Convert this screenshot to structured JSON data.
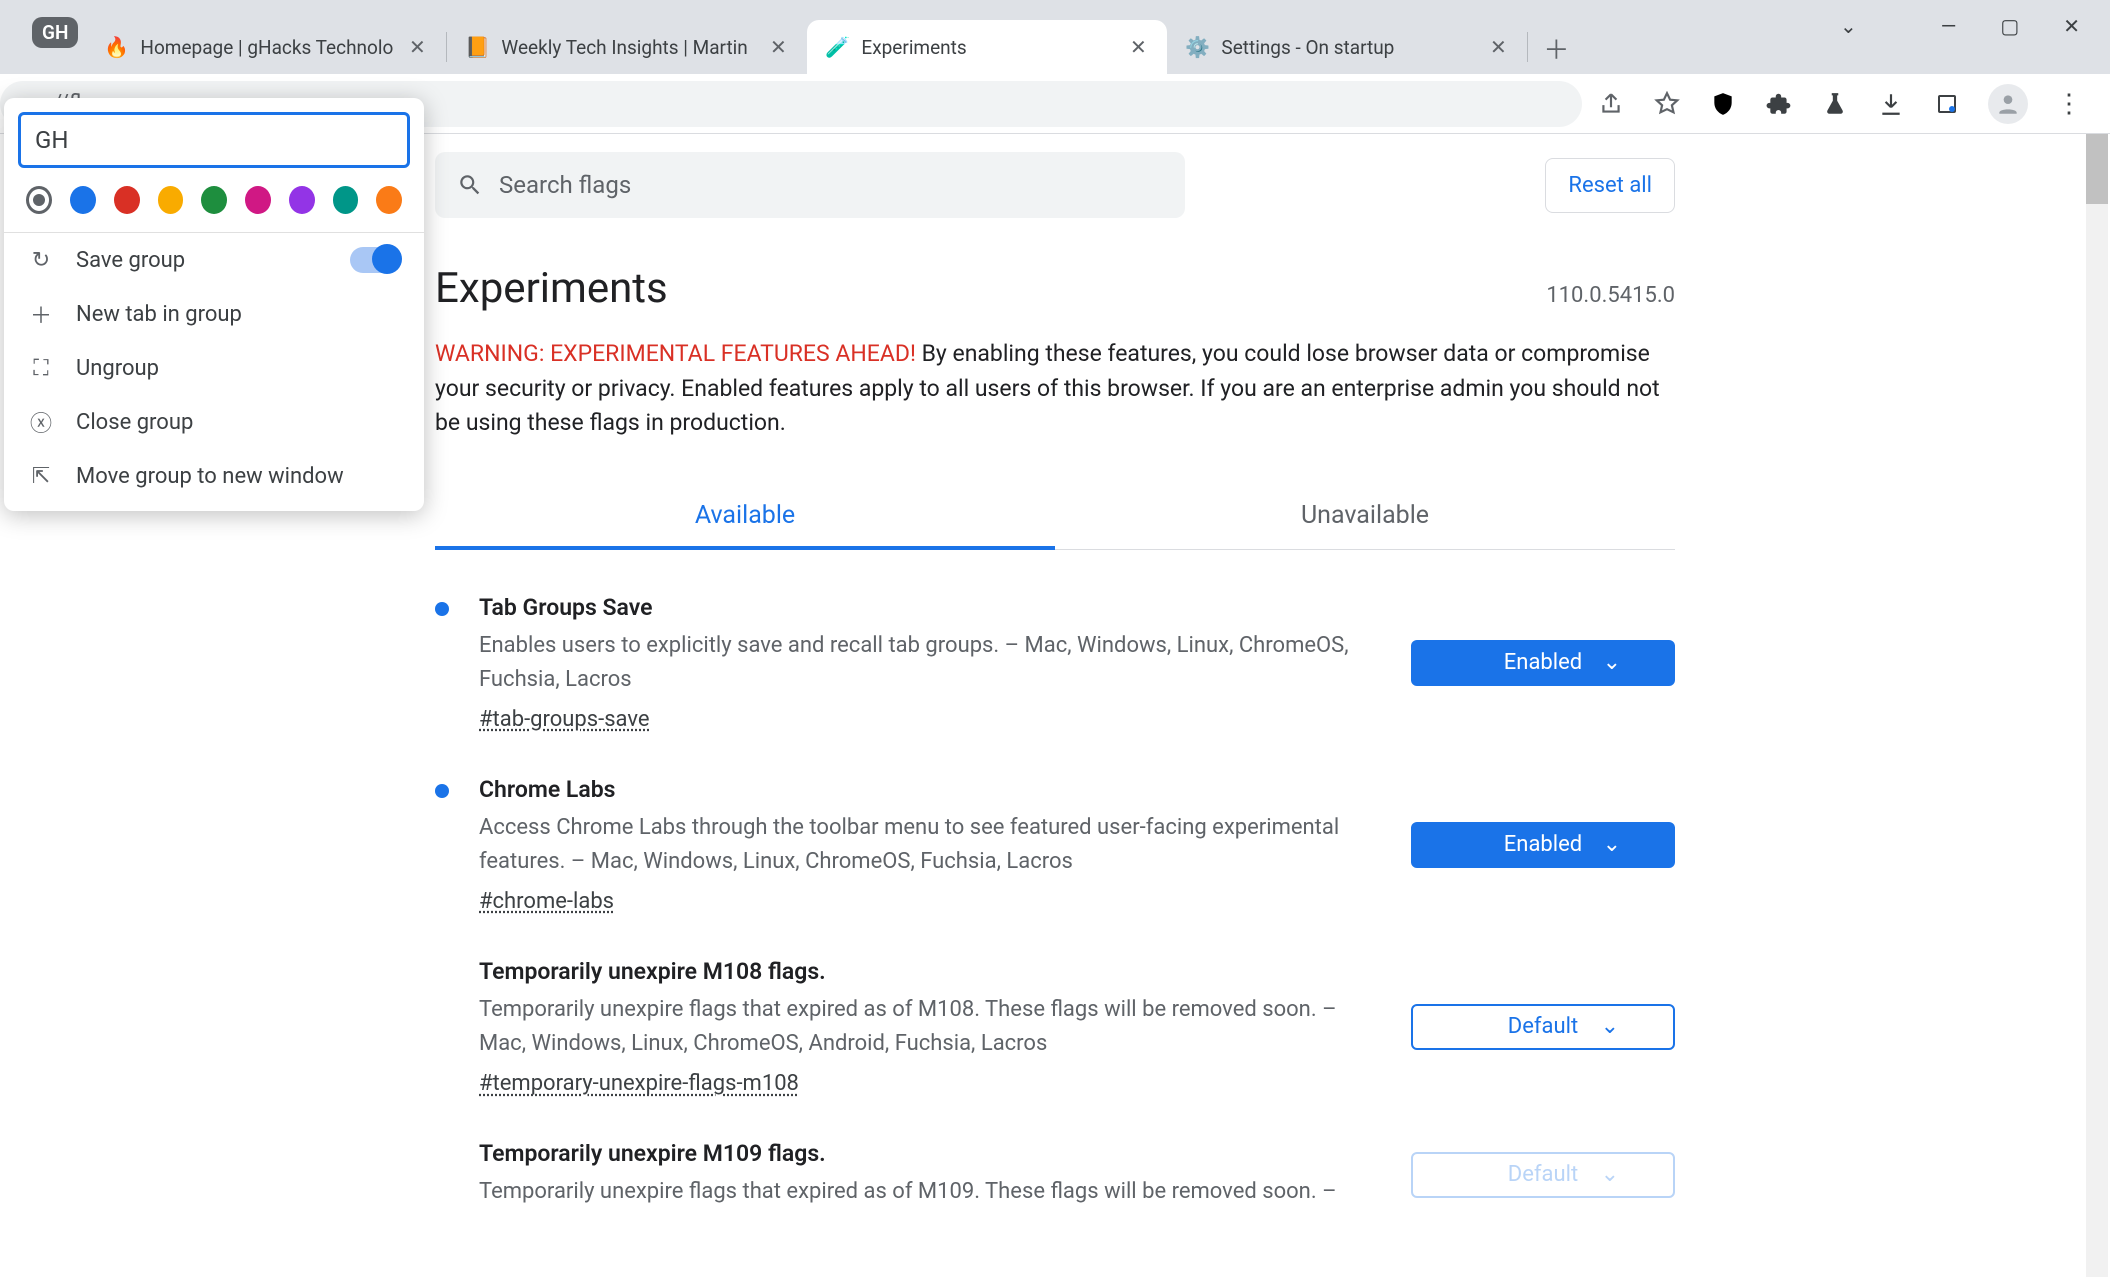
{
  "window": {
    "group_chip": "GH",
    "tabs": [
      {
        "title": "Homepage | gHacks Technolo",
        "active": false
      },
      {
        "title": "Weekly Tech Insights | Martin",
        "active": false
      },
      {
        "title": "Experiments",
        "active": true
      },
      {
        "title": "Settings - On startup",
        "active": false
      }
    ]
  },
  "omnibox": {
    "fragment": "ne://flags"
  },
  "group_popup": {
    "name_value": "GH",
    "colors": [
      "#5f6368",
      "#1a73e8",
      "#d93025",
      "#f9ab00",
      "#1e8e3e",
      "#d01884",
      "#9334e6",
      "#009688",
      "#fa7b17"
    ],
    "items": {
      "save": "Save group",
      "new_tab": "New tab in group",
      "ungroup": "Ungroup",
      "close": "Close group",
      "move": "Move group to new window"
    },
    "save_toggle_on": true
  },
  "page": {
    "search_placeholder": "Search flags",
    "reset": "Reset all",
    "title": "Experiments",
    "version": "110.0.5415.0",
    "warning_red": "WARNING: EXPERIMENTAL FEATURES AHEAD!",
    "warning_rest": " By enabling these features, you could lose browser data or compromise your security or privacy. Enabled features apply to all users of this browser. If you are an enterprise admin you should not be using these flags in production.",
    "tab_available": "Available",
    "tab_unavailable": "Unavailable",
    "flags": [
      {
        "name": "Tab Groups Save",
        "desc": "Enables users to explicitly save and recall tab groups. – Mac, Windows, Linux, ChromeOS, Fuchsia, Lacros",
        "hash": "#tab-groups-save",
        "state": "Enabled",
        "style": "enabled",
        "bullet": true
      },
      {
        "name": "Chrome Labs",
        "desc": "Access Chrome Labs through the toolbar menu to see featured user-facing experimental features. – Mac, Windows, Linux, ChromeOS, Fuchsia, Lacros",
        "hash": "#chrome-labs",
        "state": "Enabled",
        "style": "enabled",
        "bullet": true
      },
      {
        "name": "Temporarily unexpire M108 flags.",
        "desc": "Temporarily unexpire flags that expired as of M108. These flags will be removed soon. – Mac, Windows, Linux, ChromeOS, Android, Fuchsia, Lacros",
        "hash": "#temporary-unexpire-flags-m108",
        "state": "Default",
        "style": "default",
        "bullet": false
      },
      {
        "name": "Temporarily unexpire M109 flags.",
        "desc": "Temporarily unexpire flags that expired as of M109. These flags will be removed soon. –",
        "hash": "",
        "state": "Default",
        "style": "default",
        "bullet": false
      }
    ]
  }
}
